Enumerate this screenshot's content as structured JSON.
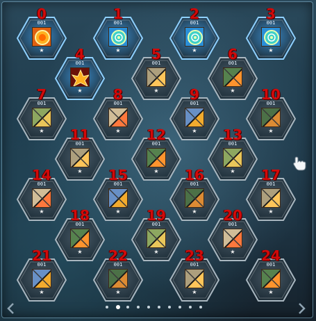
{
  "screen": "skill-slot-grid",
  "colors": {
    "slot_active": "#3c8fd0",
    "slot_inactive": "#4a5a66",
    "index_text": "#d10a0a",
    "star": "#f2f2f2"
  },
  "slots": [
    {
      "index": "0",
      "count": "001",
      "star": "★",
      "active": true,
      "icon": "sun-orb-icon"
    },
    {
      "index": "1",
      "count": "001",
      "star": "★",
      "active": true,
      "icon": "rune-circle-icon"
    },
    {
      "index": "2",
      "count": "001",
      "star": "★",
      "active": true,
      "icon": "rune-circle-icon"
    },
    {
      "index": "3",
      "count": "001",
      "star": "★",
      "active": true,
      "icon": "rune-circle-icon"
    },
    {
      "index": "4",
      "count": "001",
      "star": "★",
      "active": true,
      "icon": "flame-burst-icon"
    },
    {
      "index": "5",
      "count": "001",
      "star": "★",
      "active": false,
      "icon": "split-icon-5"
    },
    {
      "index": "6",
      "count": "001",
      "star": "★",
      "active": false,
      "icon": "split-icon-6"
    },
    {
      "index": "7",
      "count": "001",
      "star": "★",
      "active": false,
      "icon": "split-icon-7"
    },
    {
      "index": "8",
      "count": "001",
      "star": "★",
      "active": false,
      "icon": "split-icon-8"
    },
    {
      "index": "9",
      "count": "001",
      "star": "★",
      "active": false,
      "icon": "split-icon-9"
    },
    {
      "index": "10",
      "count": "001",
      "star": "★",
      "active": false,
      "icon": "split-icon-10"
    },
    {
      "index": "11",
      "count": "001",
      "star": "★",
      "active": false,
      "icon": "split-icon-11"
    },
    {
      "index": "12",
      "count": "001",
      "star": "★",
      "active": false,
      "icon": "split-icon-12"
    },
    {
      "index": "13",
      "count": "001",
      "star": "★",
      "active": false,
      "icon": "split-icon-13"
    },
    {
      "index": "14",
      "count": "001",
      "star": "★",
      "active": false,
      "icon": "split-icon-14"
    },
    {
      "index": "15",
      "count": "001",
      "star": "★",
      "active": false,
      "icon": "split-icon-15"
    },
    {
      "index": "16",
      "count": "001",
      "star": "★",
      "active": false,
      "icon": "split-icon-16"
    },
    {
      "index": "17",
      "count": "001",
      "star": "★",
      "active": false,
      "icon": "split-icon-17"
    },
    {
      "index": "18",
      "count": "001",
      "star": "★",
      "active": false,
      "icon": "split-icon-18"
    },
    {
      "index": "19",
      "count": "001",
      "star": "★",
      "active": false,
      "icon": "split-icon-19"
    },
    {
      "index": "20",
      "count": "001",
      "star": "★",
      "active": false,
      "icon": "split-icon-20"
    },
    {
      "index": "21",
      "count": "001",
      "star": "★",
      "active": false,
      "icon": "split-icon-21"
    },
    {
      "index": "22",
      "count": "001",
      "star": "★",
      "active": false,
      "icon": "split-icon-22"
    },
    {
      "index": "23",
      "count": "001",
      "star": "★",
      "active": false,
      "icon": "split-icon-23"
    },
    {
      "index": "24",
      "count": "001",
      "star": "★",
      "active": false,
      "icon": "split-icon-24"
    }
  ],
  "pagination": {
    "total_pages": 10,
    "current_page": 2
  },
  "nav": {
    "prev_icon": "chevron-left-icon",
    "next_icon": "chevron-right-icon"
  },
  "cursor_icon": "hand-pointer-icon"
}
